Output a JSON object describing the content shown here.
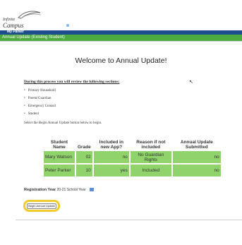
{
  "logo": {
    "line1": "Infinite",
    "line2": "Campus"
  },
  "user_bar": {
    "name": "My Parker"
  },
  "breadcrumb": "Annual Update (Existing Student)",
  "main": {
    "title": "Welcome to Annual Update!",
    "intro": "During this process you will review the following sections:",
    "sections": [
      "Primary Household",
      "Parent/Guardian",
      "Emergency Contact",
      "Student"
    ],
    "select_text": "Select the Begin Annual Update button below to begin."
  },
  "table": {
    "headers": [
      "Student Name",
      "Grade",
      "Included in new App?",
      "Reason if not included",
      "Annual Update Submitted"
    ],
    "rows": [
      [
        "Mary Watson",
        "02",
        "no",
        "No Guardian Rights",
        "no"
      ],
      [
        "Peter Parker",
        "10",
        "yes",
        "Included",
        "no"
      ]
    ]
  },
  "registration": {
    "label": "Registration Year",
    "value": "20-21 School Year"
  },
  "begin_button": "Begin Annual Update",
  "colors": {
    "accent_green": "#4caa3e",
    "row_green": "#8fd36a",
    "user_bar_blue": "#1e4f8c",
    "highlight": "#f0cc2e"
  }
}
